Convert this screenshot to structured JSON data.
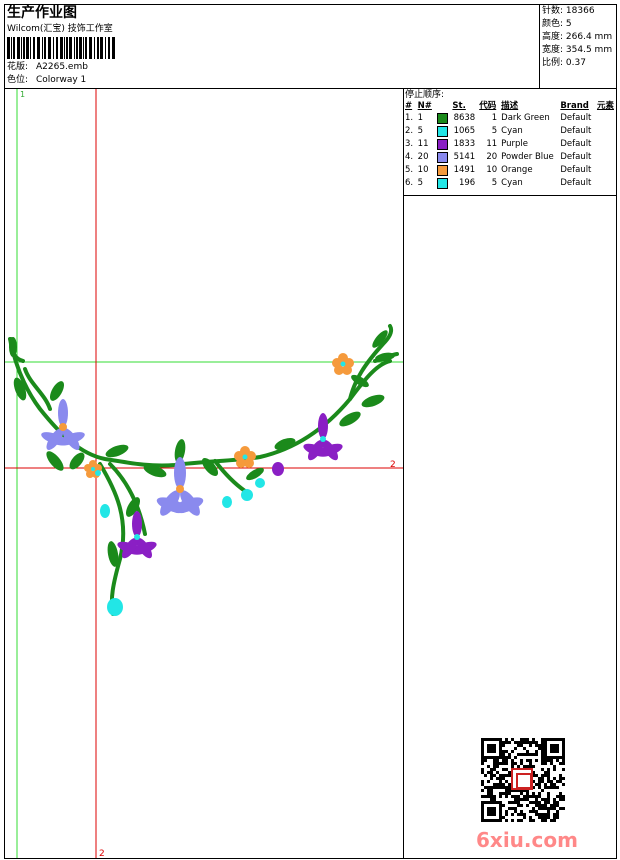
{
  "header": {
    "title": "生产作业图",
    "company": "Wilcom(汇宝) 技饰工作室",
    "design_label": "花版:",
    "design_value": "A2265.emb",
    "colorway_label": "色位:",
    "colorway_value": "Colorway 1"
  },
  "stats": [
    {
      "label": "针数:",
      "value": "18366"
    },
    {
      "label": "颜色:",
      "value": "5"
    },
    {
      "label": "高度:",
      "value": "266.4 mm"
    },
    {
      "label": "宽度:",
      "value": "354.5 mm"
    },
    {
      "label": "比例:",
      "value": "0.37"
    }
  ],
  "stop_sequence": {
    "title": "停止顺序:",
    "columns": [
      "#",
      "N#",
      "St.",
      "代码",
      "描述",
      "Brand",
      "元素"
    ],
    "rows": [
      {
        "idx": "1.",
        "n": "1",
        "st": "8638",
        "code": "1",
        "desc": "Dark Green",
        "brand": "Default",
        "color": "#1b8a1b"
      },
      {
        "idx": "2.",
        "n": "5",
        "st": "1065",
        "code": "5",
        "desc": "Cyan",
        "brand": "Default",
        "color": "#22e6e6"
      },
      {
        "idx": "3.",
        "n": "11",
        "st": "1833",
        "code": "11",
        "desc": "Purple",
        "brand": "Default",
        "color": "#8a1fc4"
      },
      {
        "idx": "4.",
        "n": "20",
        "st": "5141",
        "code": "20",
        "desc": "Powder Blue",
        "brand": "Default",
        "color": "#8a8aee"
      },
      {
        "idx": "5.",
        "n": "10",
        "st": "1491",
        "code": "10",
        "desc": "Orange",
        "brand": "Default",
        "color": "#f59a3c"
      },
      {
        "idx": "6.",
        "n": "5",
        "st": "196",
        "code": "5",
        "desc": "Cyan",
        "brand": "Default",
        "color": "#22e6e6"
      }
    ]
  },
  "guides": {
    "green_marker": "1",
    "red_v_marker": "2",
    "red_h_marker": "2"
  },
  "colors": {
    "green_guide": "#33dd33",
    "red_guide": "#dd0000",
    "vine": "#1b8a1b",
    "powder_blue": "#8a8aee",
    "purple": "#8a1fc4",
    "orange": "#f59a3c",
    "cyan": "#22e6e6"
  },
  "watermark": {
    "site": "6xiu.com",
    "seal_icon": "red-seal-icon",
    "qr_icon": "qr-code-icon"
  }
}
